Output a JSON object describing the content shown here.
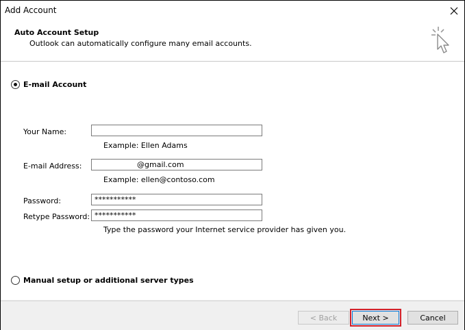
{
  "window": {
    "title": "Add Account"
  },
  "header": {
    "title": "Auto Account Setup",
    "subtitle": "Outlook can automatically configure many email accounts."
  },
  "email_account": {
    "option_label": "E-mail Account",
    "selected": true,
    "fields": {
      "name_label": "Your Name:",
      "name_value": "",
      "name_hint": "Example: Ellen Adams",
      "email_label": "E-mail Address:",
      "email_value": "@gmail.com",
      "email_hint": "Example: ellen@contoso.com",
      "password_label": "Password:",
      "password_value": "***********",
      "retype_label": "Retype Password:",
      "retype_value": "***********",
      "password_hint": "Type the password your Internet service provider has given you."
    }
  },
  "manual_setup": {
    "option_label": "Manual setup or additional server types",
    "selected": false
  },
  "buttons": {
    "back": "< Back",
    "next": "Next >",
    "cancel": "Cancel"
  },
  "colors": {
    "highlight": "#d0202a"
  }
}
